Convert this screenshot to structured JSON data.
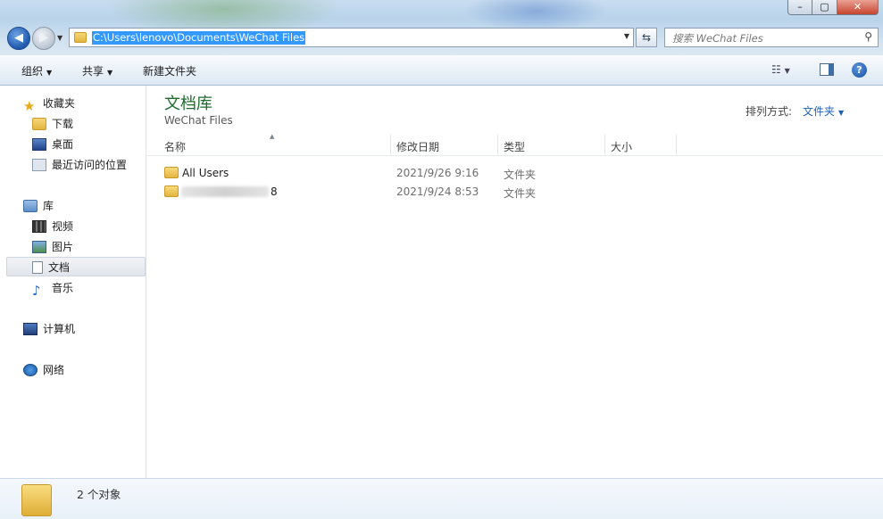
{
  "address": {
    "path": "C:\\Users\\lenovo\\Documents\\WeChat Files"
  },
  "search": {
    "placeholder": "搜索 WeChat Files"
  },
  "toolbar": {
    "organize": "组织",
    "share": "共享",
    "new_folder": "新建文件夹"
  },
  "sidebar": {
    "favorites": "收藏夹",
    "downloads": "下载",
    "desktop": "桌面",
    "recent": "最近访问的位置",
    "libraries": "库",
    "videos": "视频",
    "pictures": "图片",
    "documents": "文档",
    "music": "音乐",
    "computer": "计算机",
    "network": "网络"
  },
  "content": {
    "library_title": "文档库",
    "library_subtitle": "WeChat Files",
    "arrange_label": "排列方式:",
    "arrange_value": "文件夹",
    "columns": {
      "name": "名称",
      "modified": "修改日期",
      "type": "类型",
      "size": "大小"
    },
    "rows": [
      {
        "name": "All Users",
        "modified": "2021/9/26 9:16",
        "type": "文件夹"
      },
      {
        "name_tail": "8",
        "modified": "2021/9/24 8:53",
        "type": "文件夹"
      }
    ]
  },
  "details": {
    "count": "2 个对象"
  }
}
